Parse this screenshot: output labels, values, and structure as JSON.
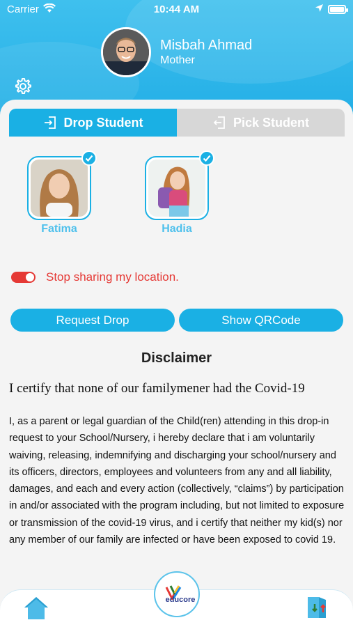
{
  "status_bar": {
    "carrier": "Carrier",
    "time": "10:44 AM"
  },
  "profile": {
    "name": "Misbah Ahmad",
    "role": "Mother"
  },
  "tabs": [
    {
      "label": "Drop Student",
      "active": true
    },
    {
      "label": "Pick Student",
      "active": false
    }
  ],
  "students": [
    {
      "name": "Fatima",
      "selected": true
    },
    {
      "name": "Hadia",
      "selected": true
    }
  ],
  "location_toggle": {
    "label": "Stop sharing my location.",
    "on": true
  },
  "actions": {
    "request_label": "Request Drop",
    "qr_label": "Show QRCode"
  },
  "disclaimer": {
    "title": "Disclaimer",
    "subtitle": "I certify that none of our familymener had the Covid-19",
    "body": "I, as a parent or legal guardian of the Child(ren) attending in this drop-in request to your School/Nursery, i hereby declare that i am voluntarily waiving, releasing, indemnifying and discharging your school/nursery and its officers, directors, employees and volunteers from any and all liability, damages, and each and every action (collectively, “claims”) by participation in and/or associated with the program including, but not limited to exposure or transmission of the covid-19 virus, and i certify that neither my kid(s) nor any member of our family are infected or have been exposed to covid 19."
  },
  "bottom_nav": {
    "logo_text": "educore"
  },
  "colors": {
    "primary": "#1ab0e4",
    "alert": "#e53935",
    "name_text": "#4dc0ec"
  },
  "icons": [
    "wifi-icon",
    "location-arrow-icon",
    "battery-icon",
    "gear-icon",
    "login-icon",
    "logout-icon",
    "checkmark-icon",
    "home-icon",
    "exit-door-icon"
  ]
}
